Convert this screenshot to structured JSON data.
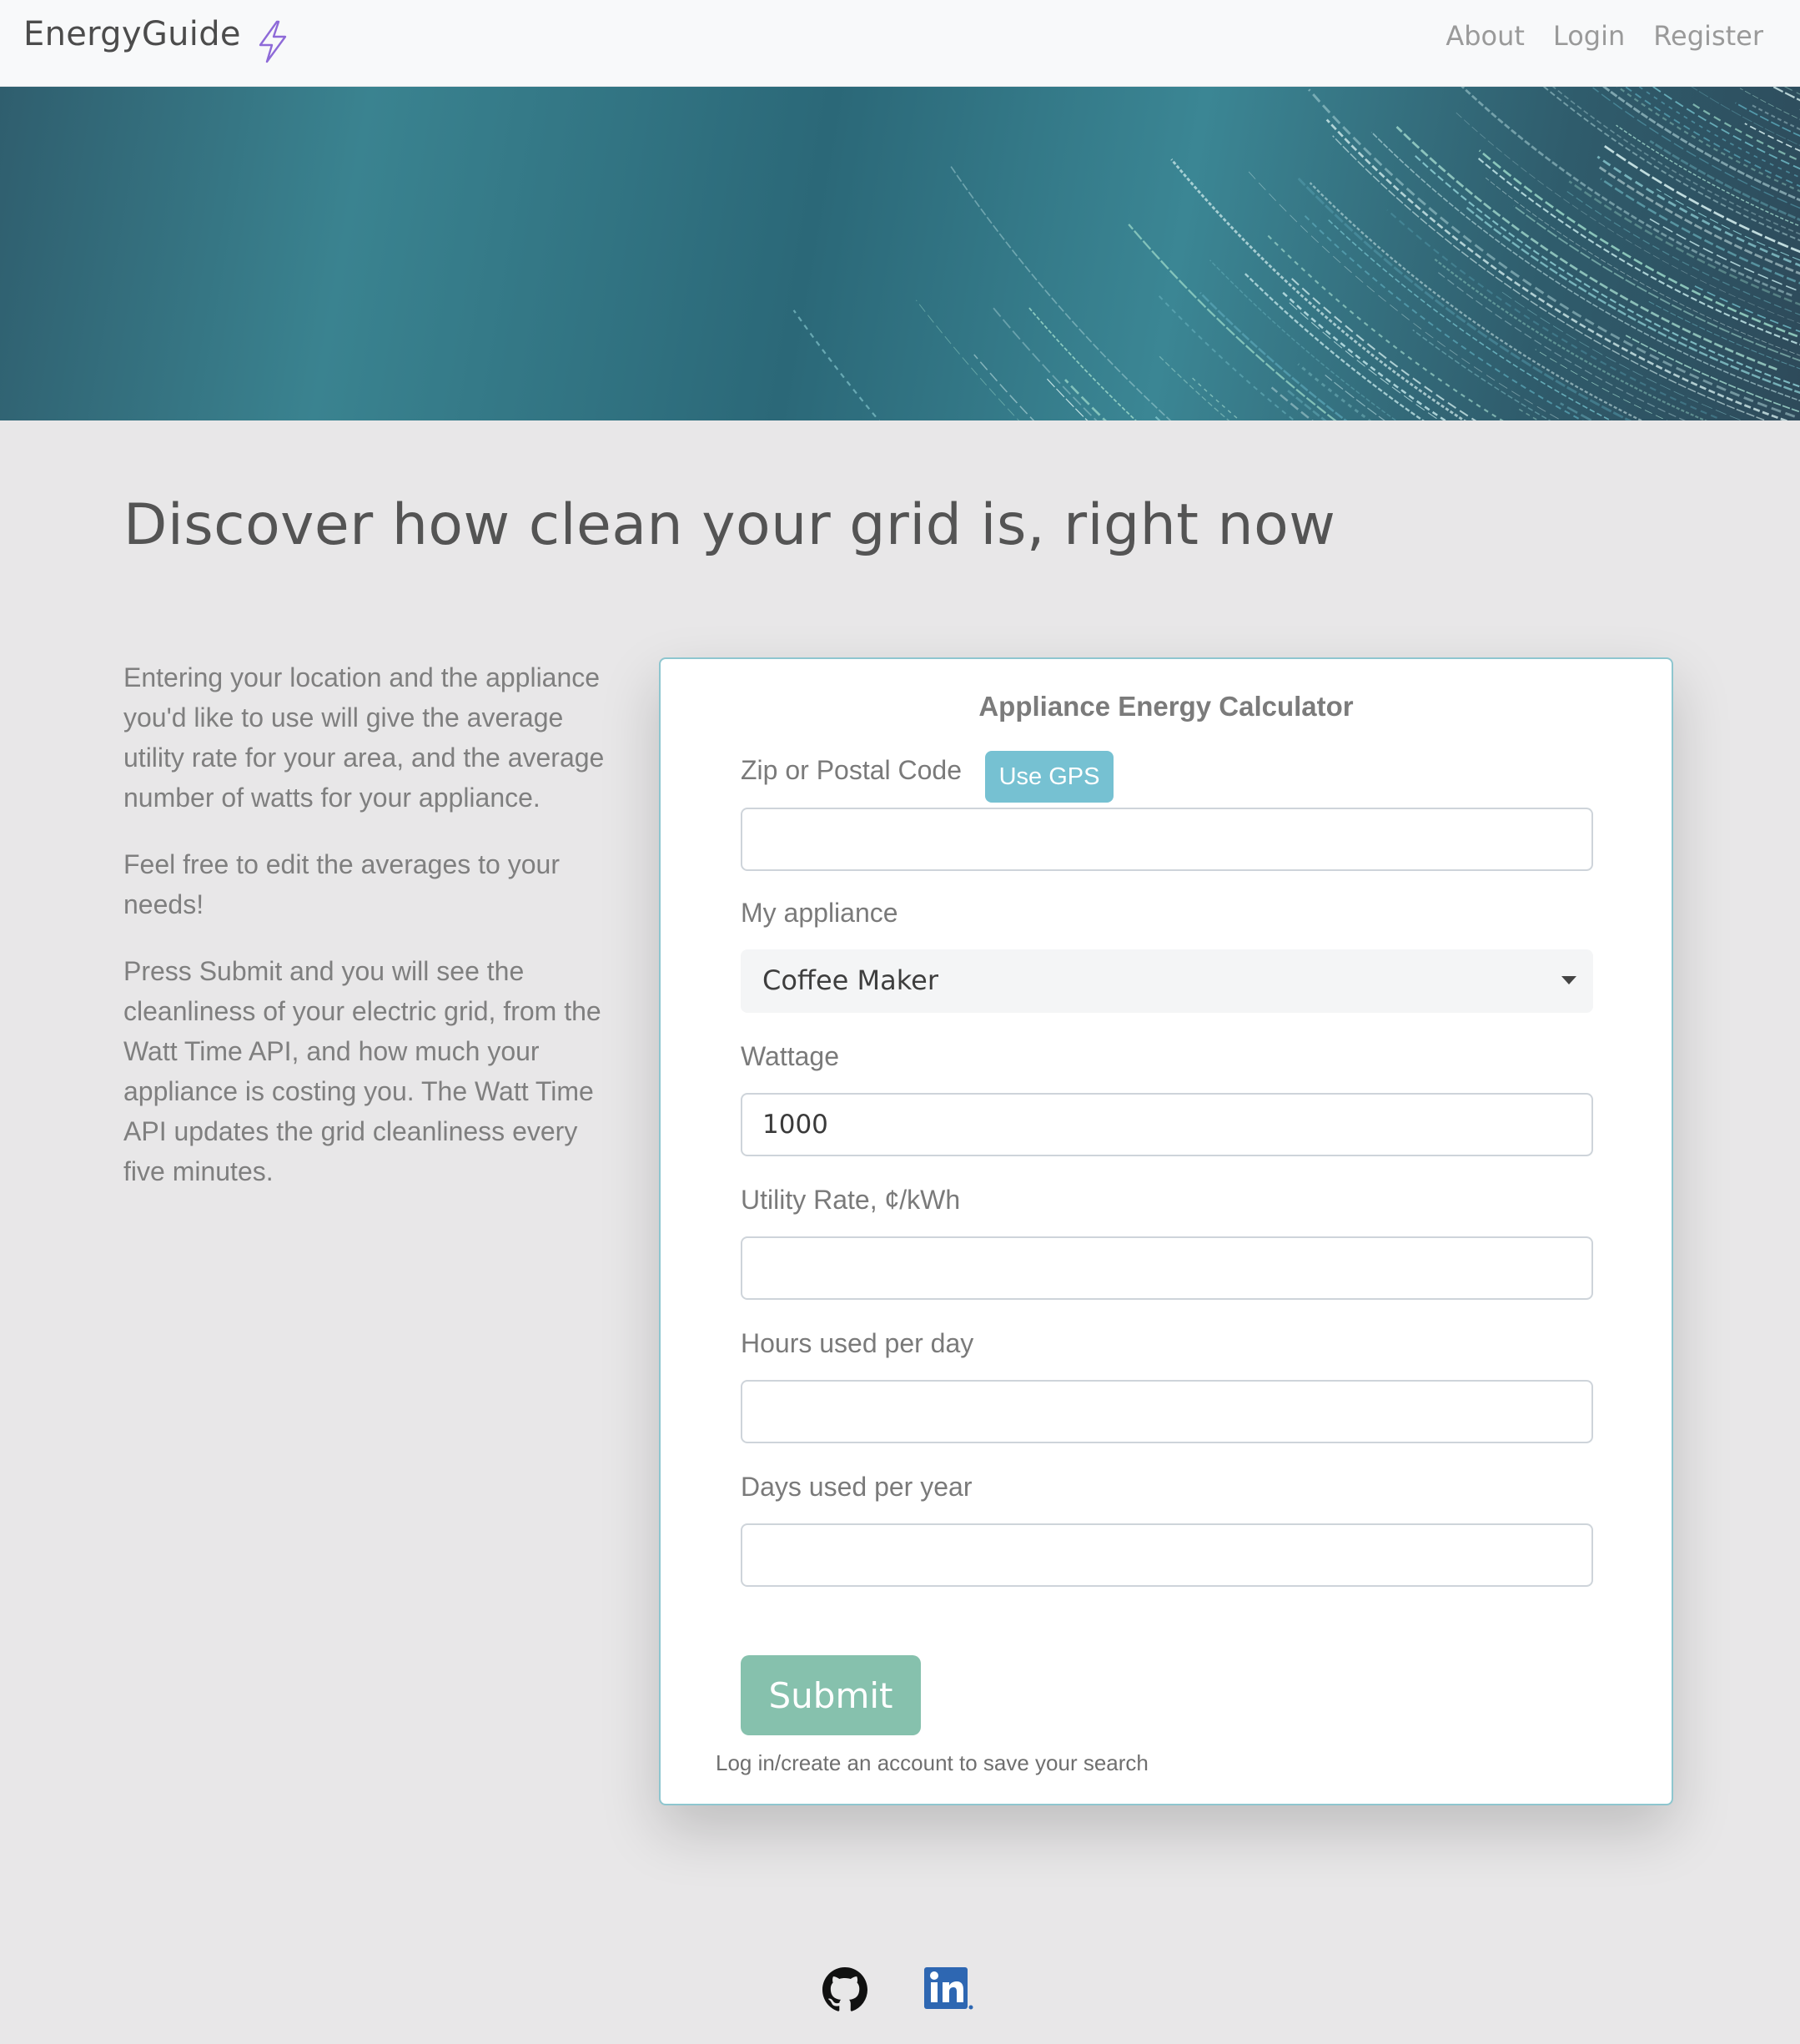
{
  "navbar": {
    "brand": "EnergyGuide",
    "brand_icon": "lightning-bolt-icon",
    "links": [
      "About",
      "Login",
      "Register"
    ]
  },
  "hero": {
    "image": "star-trails-photo"
  },
  "headline": "Discover how clean your grid is, right now",
  "intro": {
    "paragraphs": [
      "Entering your location and the appliance you'd like to use will give the average utility rate for your area, and the average number of watts for your appliance.",
      "Feel free to edit the averages to your needs!",
      "Press Submit and you will see the cleanliness of your electric grid, from the Watt Time API, and how much your appliance is costing you. The Watt Time API updates the grid cleanliness every five minutes."
    ]
  },
  "calculator": {
    "title": "Appliance Energy Calculator",
    "zip": {
      "label": "Zip or Postal Code",
      "gps_button": "Use GPS",
      "value": ""
    },
    "appliance": {
      "label": "My appliance",
      "selected": "Coffee Maker"
    },
    "wattage": {
      "label": "Wattage",
      "value": "1000"
    },
    "rate": {
      "label": "Utility Rate, ¢/kWh",
      "value": ""
    },
    "hours": {
      "label": "Hours used per day",
      "value": ""
    },
    "days": {
      "label": "Days used per year",
      "value": ""
    },
    "submit": "Submit",
    "save_note": "Log in/create an account to save your search"
  },
  "footer": {
    "icons": [
      "github-icon",
      "linkedin-icon"
    ]
  },
  "colors": {
    "background": "#e8e7e8",
    "card_border": "#8ec6cf",
    "gps_button": "#76c1d2",
    "submit_button": "#86c1ad",
    "bolt": "#8e6ad8",
    "linkedin": "#2e67b2"
  }
}
